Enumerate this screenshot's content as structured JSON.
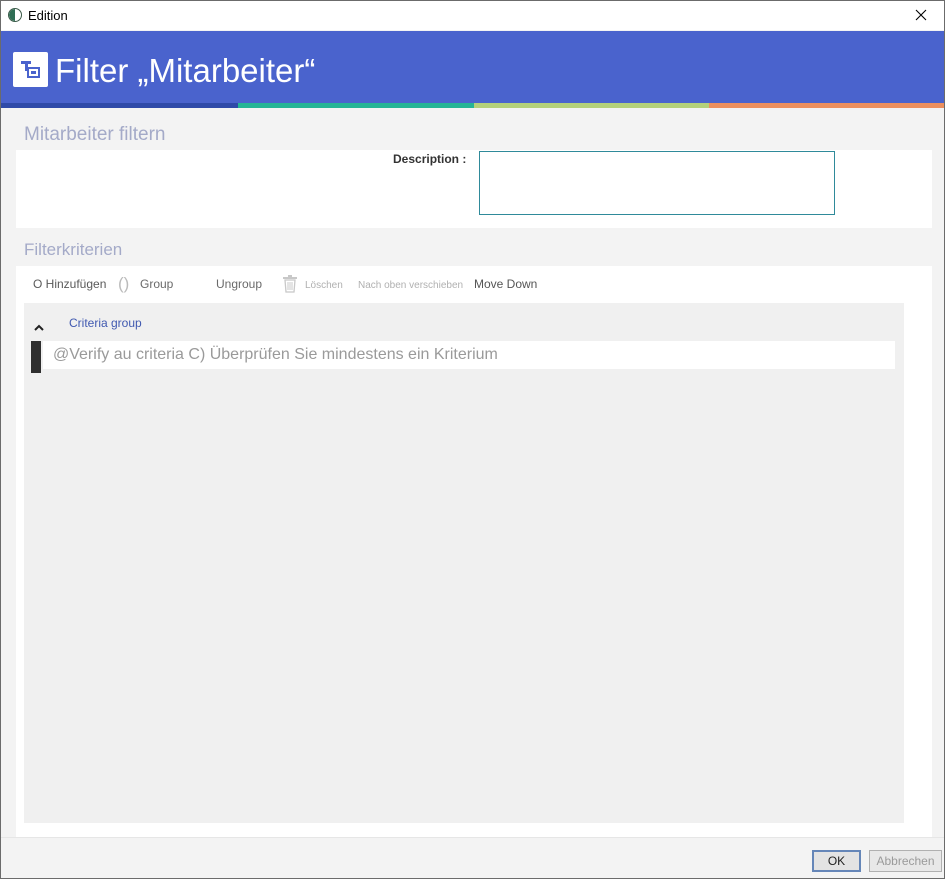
{
  "window": {
    "title": "Edition",
    "close_icon": "close-icon"
  },
  "header": {
    "title": "Filter „Mitarbeiter“",
    "icon": "filter-icon",
    "colors": {
      "banner": "#4a63cd",
      "stripe": [
        "#2f4aa8",
        "#25b495",
        "#b4d07a",
        "#ec8f5e"
      ]
    }
  },
  "filter_section": {
    "title": "Mitarbeiter filtern",
    "description_label": "Description :",
    "description_value": ""
  },
  "criteria_section": {
    "title": "Filterkriterien",
    "toolbar": {
      "add_label": "O Hinzufügen",
      "group_icon": "()",
      "group_label": "Group",
      "ungroup_label": "Ungroup",
      "trash_icon": "trash-icon",
      "delete_label": "Löschen",
      "move_up_label": "Nach oben verschieben",
      "move_down_label": "Move Down"
    },
    "group": {
      "label": "Criteria group",
      "chevron_icon": "chevron-up-icon",
      "validation_message": "@Verify au criteria C) Überprüfen Sie mindestens ein Kriterium"
    }
  },
  "footer": {
    "ok_label": "OK",
    "cancel_label": "Abbrechen"
  }
}
